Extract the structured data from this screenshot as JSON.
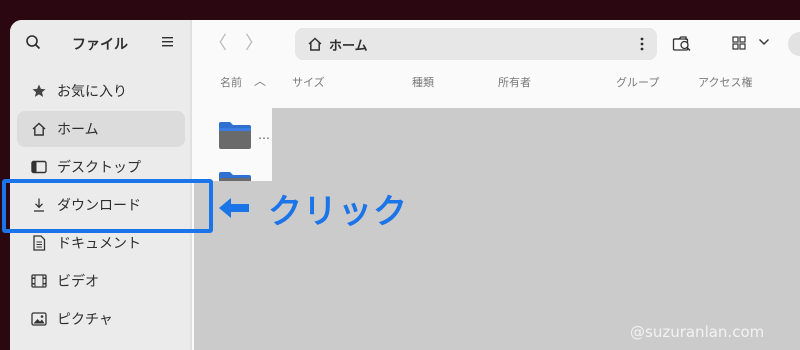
{
  "sidebar": {
    "title": "ファイル",
    "items": [
      {
        "label": "お気に入り",
        "icon": "star-icon"
      },
      {
        "label": "ホーム",
        "icon": "home-icon",
        "active": true
      },
      {
        "label": "デスクトップ",
        "icon": "desktop-icon"
      },
      {
        "label": "ダウンロード",
        "icon": "download-icon"
      },
      {
        "label": "ドキュメント",
        "icon": "document-icon"
      },
      {
        "label": "ビデオ",
        "icon": "video-icon"
      },
      {
        "label": "ピクチャ",
        "icon": "picture-icon"
      }
    ]
  },
  "header": {
    "back": "〈",
    "forward": "〉",
    "path_label": "ホーム"
  },
  "columns": {
    "name": "名前",
    "size": "サイズ",
    "type": "種類",
    "owner": "所有者",
    "group": "グループ",
    "access": "アクセス権"
  },
  "files": {
    "row1_name": "…"
  },
  "annotation": {
    "text": "クリック"
  },
  "watermark": "@suzuranlan.com",
  "colors": {
    "accent": "#1c75e8",
    "background": "#2b0712",
    "sidebar": "#ebebeb",
    "overlay": "#cbcbcb"
  }
}
